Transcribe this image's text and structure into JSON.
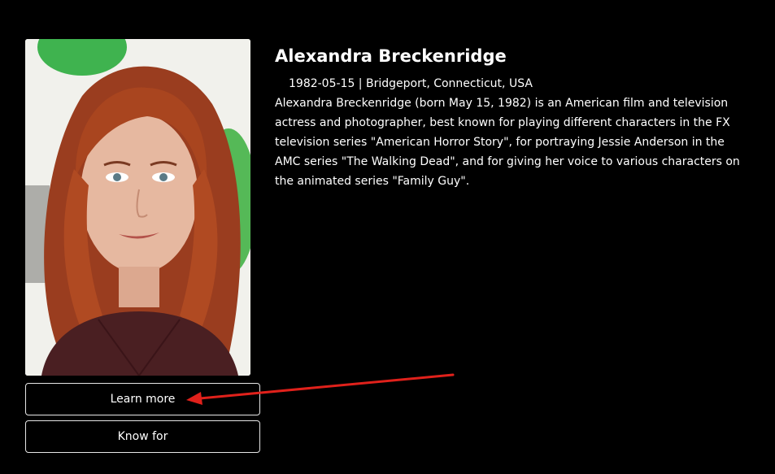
{
  "person": {
    "name": "Alexandra Breckenridge",
    "meta": "1982-05-15 | Bridgeport, Connecticut, USA",
    "bio": "Alexandra Breckenridge (born May 15, 1982) is an American film and television actress and photographer, best known for playing different characters in the FX television series \"American Horror Story\", for portraying Jessie Anderson in the AMC series \"The Walking Dead\", and for giving her voice to various characters on the animated series \"Family Guy\"."
  },
  "buttons": {
    "learn_more": "Learn more",
    "known_for": "Know for"
  },
  "annotation": {
    "arrow_color": "#e0211b"
  },
  "icons": [
    "annotation-arrow-icon"
  ]
}
